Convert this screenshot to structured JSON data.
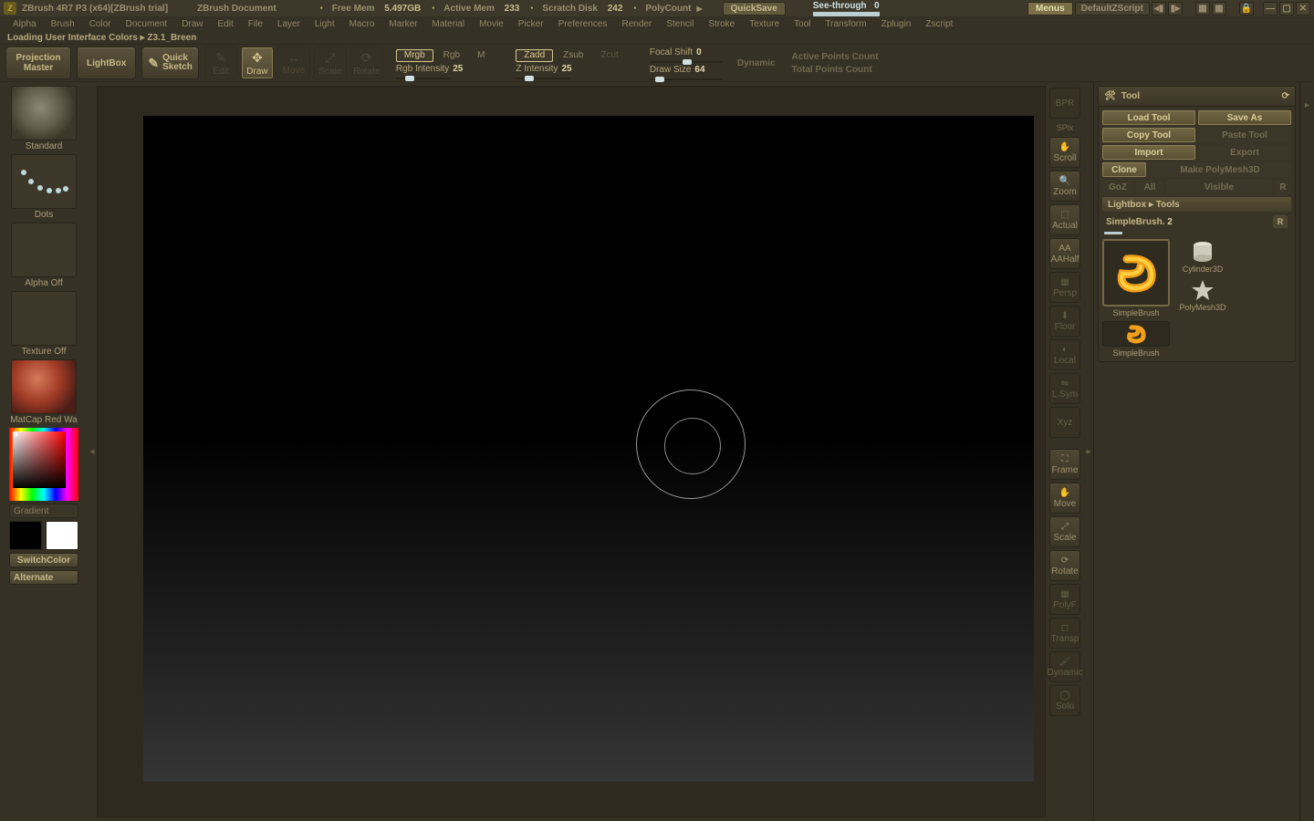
{
  "title": {
    "app": "ZBrush 4R7 P3 (x64)[ZBrush trial]",
    "doc": "ZBrush Document",
    "freemem_label": "Free Mem",
    "freemem_val": "5.497GB",
    "activemem_label": "Active Mem",
    "activemem_val": "233",
    "scratch_label": "Scratch Disk",
    "scratch_val": "242",
    "polycount_label": "PolyCount",
    "quicksave": "QuickSave",
    "seethrough": "See-through",
    "seethrough_val": "0",
    "menus": "Menus",
    "script": "DefaultZScript"
  },
  "menus": [
    "Alpha",
    "Brush",
    "Color",
    "Document",
    "Draw",
    "Edit",
    "File",
    "Layer",
    "Light",
    "Macro",
    "Marker",
    "Material",
    "Movie",
    "Picker",
    "Preferences",
    "Render",
    "Stencil",
    "Stroke",
    "Texture",
    "Tool",
    "Transform",
    "Zplugin",
    "Zscript"
  ],
  "status": "Loading User Interface Colors ▸ Z3.1_Breen",
  "shelf": {
    "projection": "Projection Master",
    "lightbox": "LightBox",
    "quicksketch_a": "Quick",
    "quicksketch_b": "Sketch",
    "modes": [
      "Edit",
      "Draw",
      "Move",
      "Scale",
      "Rotate"
    ],
    "mrgb": "Mrgb",
    "rgb": "Rgb",
    "m": "M",
    "rgbint": "Rgb Intensity",
    "rgbint_val": "25",
    "zadd": "Zadd",
    "zsub": "Zsub",
    "zcut": "Zcut",
    "zint": "Z Intensity",
    "zint_val": "25",
    "focal": "Focal Shift",
    "focal_val": "0",
    "draws": "Draw Size",
    "draws_val": "64",
    "dynamic": "Dynamic",
    "apc": "Active Points Count",
    "tpc": "Total Points Count"
  },
  "left": {
    "brush": "Standard",
    "stroke": "Dots",
    "alpha": "Alpha Off",
    "texture": "Texture Off",
    "material": "MatCap Red Wa",
    "gradient": "Gradient",
    "switchcolor": "SwitchColor",
    "alternate": "Alternate"
  },
  "right": {
    "bpr": "BPR",
    "spix": "SPix",
    "scroll": "Scroll",
    "zoom": "Zoom",
    "actual": "Actual",
    "aahalf": "AAHalf",
    "persp": "Persp",
    "floor": "Floor",
    "local": "Local",
    "lsym": "L.Sym",
    "xyz": "Xyz",
    "frame": "Frame",
    "move": "Move",
    "scale": "Scale",
    "rotate": "Rotate",
    "polyf": "PolyF",
    "transp": "Transp",
    "dynamic": "Dynamic",
    "solo": "Solo"
  },
  "toolpanel": {
    "title": "Tool",
    "refresh": "⟳",
    "load": "Load Tool",
    "saveas": "Save As",
    "copy": "Copy Tool",
    "paste": "Paste Tool",
    "import": "Import",
    "export": "Export",
    "clone": "Clone",
    "makepm": "Make PolyMesh3D",
    "goz": "GoZ",
    "all": "All",
    "visible": "Visible",
    "r": "R",
    "crumb": "Lightbox ▸ Tools",
    "toolname": "SimpleBrush.",
    "toolnum": "2",
    "items": [
      {
        "name": "SimpleBrush"
      },
      {
        "name": "Cylinder3D"
      },
      {
        "name": "PolyMesh3D"
      },
      {
        "name": "SimpleBrush"
      }
    ]
  }
}
